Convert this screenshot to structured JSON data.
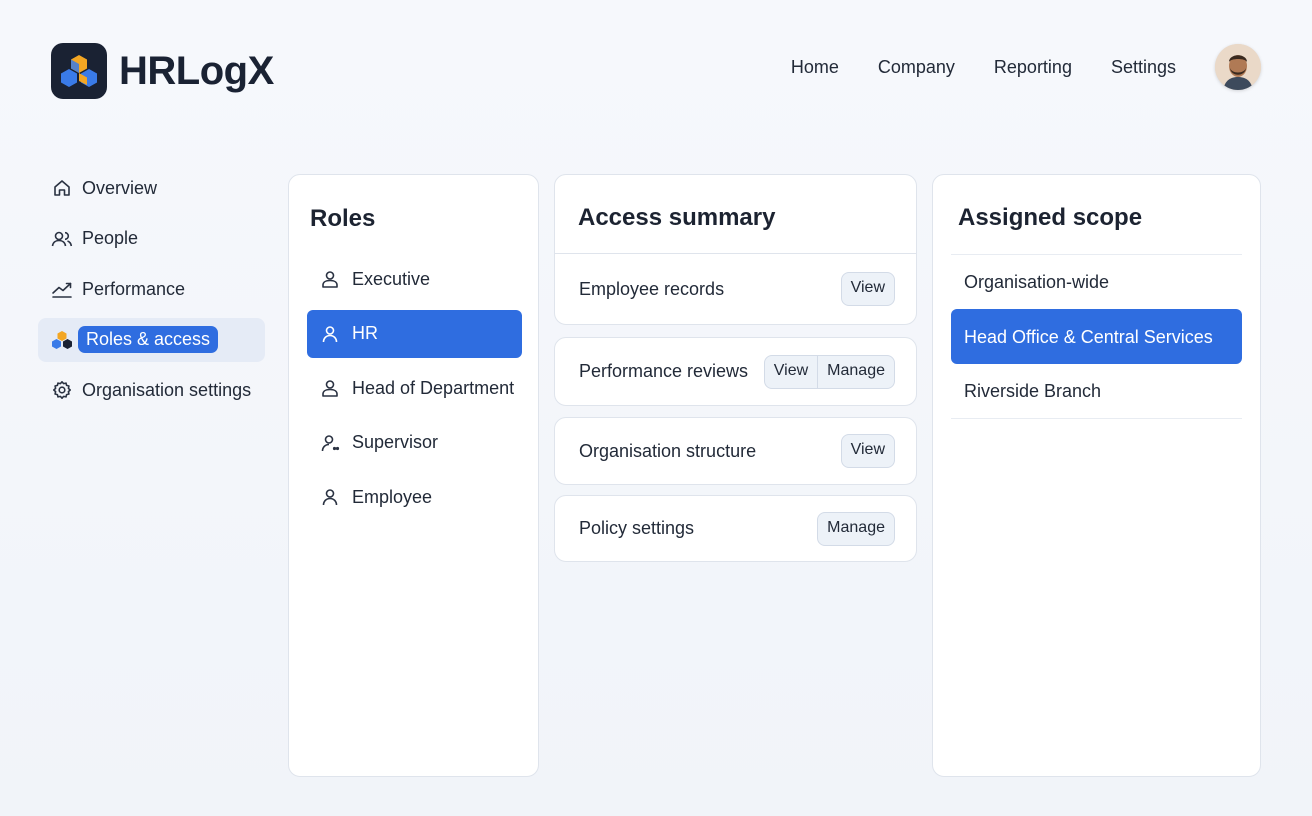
{
  "app": {
    "name": "HRLogX"
  },
  "topnav": [
    {
      "label": "Home"
    },
    {
      "label": "Company"
    },
    {
      "label": "Reporting"
    },
    {
      "label": "Settings"
    }
  ],
  "sidebar": {
    "items": [
      {
        "label": "Overview",
        "icon": "home-icon"
      },
      {
        "label": "People",
        "icon": "people-icon"
      },
      {
        "label": "Performance",
        "icon": "trend-icon"
      },
      {
        "label": "Roles & access",
        "icon": "logo-hex-icon",
        "active": true
      },
      {
        "label": "Organisation settings",
        "icon": "gear-icon"
      }
    ]
  },
  "roles": {
    "title": "Roles",
    "items": [
      {
        "label": "Executive"
      },
      {
        "label": "HR",
        "active": true
      },
      {
        "label": "Head of Department"
      },
      {
        "label": "Supervisor"
      },
      {
        "label": "Employee"
      }
    ]
  },
  "access": {
    "title": "Access summary",
    "rows": [
      {
        "label": "Employee records",
        "buttons": [
          "View"
        ]
      },
      {
        "label": "Performance reviews",
        "buttons": [
          "View",
          "Manage"
        ]
      },
      {
        "label": "Organisation structure",
        "buttons": [
          "View"
        ]
      },
      {
        "label": "Policy settings",
        "buttons": [
          "Manage"
        ]
      }
    ]
  },
  "scope": {
    "title": "Assigned scope",
    "items": [
      {
        "label": "Organisation-wide"
      },
      {
        "label": "Head Office & Central Services",
        "active": true
      },
      {
        "label": "Riverside Branch"
      }
    ]
  },
  "colors": {
    "accent": "#2f6de0",
    "logo_bg": "#1a2233",
    "logo_blue": "#3a7be8",
    "logo_orange": "#f3a623"
  }
}
